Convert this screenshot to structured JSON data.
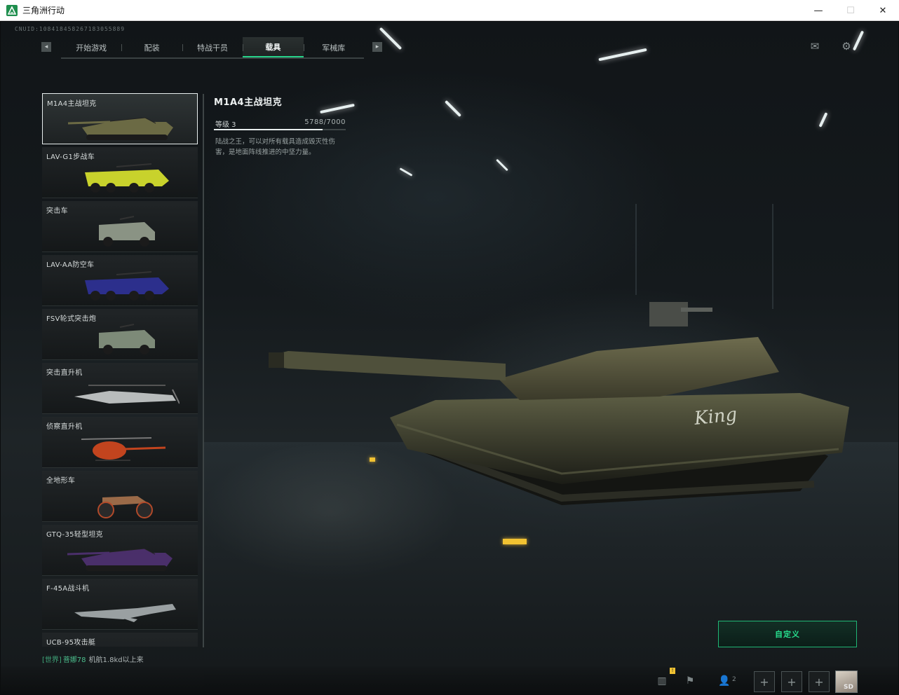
{
  "window": {
    "title": "三角洲行动",
    "minimize": "—",
    "maximize": "☐",
    "close": "✕"
  },
  "header": {
    "uid": "CNUID:108418458267183055889",
    "tabs": [
      {
        "label": "开始游戏"
      },
      {
        "label": "配装"
      },
      {
        "label": "特战干员"
      },
      {
        "label": "载具",
        "active": true
      },
      {
        "label": "军械库"
      }
    ],
    "prev_icon": "mail-prev",
    "next_icon": "nav-next"
  },
  "vehicles": [
    {
      "name": "M1A4主战坦克",
      "selected": true,
      "kind": "tank",
      "color": "#6b6a44"
    },
    {
      "name": "LAV-G1步战车",
      "kind": "apc",
      "color": "#c8d22c"
    },
    {
      "name": "突击车",
      "kind": "jeep",
      "color": "#8a9384"
    },
    {
      "name": "LAV-AA防空车",
      "kind": "apc",
      "color": "#2c2f8c"
    },
    {
      "name": "FSV轮式突击炮",
      "kind": "jeep",
      "color": "#7d8a78"
    },
    {
      "name": "突击直升机",
      "kind": "heli",
      "color": "#b8bcbc"
    },
    {
      "name": "侦察直升机",
      "kind": "heli-small",
      "color": "#c2441e"
    },
    {
      "name": "全地形车",
      "kind": "atv",
      "color": "#9a6a48"
    },
    {
      "name": "GTQ-35轻型坦克",
      "kind": "tank",
      "color": "#4a2f6a"
    },
    {
      "name": "F-45A战斗机",
      "kind": "jet",
      "color": "#9aa0a2"
    },
    {
      "name": "UCB-95攻击艇",
      "kind": "boat",
      "color": "#6a7070"
    }
  ],
  "detail": {
    "name": "M1A4主战坦克",
    "level_label": "等级 3",
    "progress_text": "5788/7000",
    "progress_fraction": 0.827,
    "description": "陆战之王，可以对所有载具造成毁灭性伤害，是地面阵线推进的中坚力量。"
  },
  "customize_label": "自定义",
  "chat": {
    "channel": "[世界]",
    "user": "菩娜78",
    "message": "机航1.8kd以上来"
  },
  "bottom": {
    "alert_badge": "!",
    "friend_count": "2",
    "slot_glyph": "+",
    "avatar_label": "SD"
  },
  "colors": {
    "accent": "#27d38a",
    "selected_border": "#e8eeee",
    "background": "#0b0d0e"
  }
}
